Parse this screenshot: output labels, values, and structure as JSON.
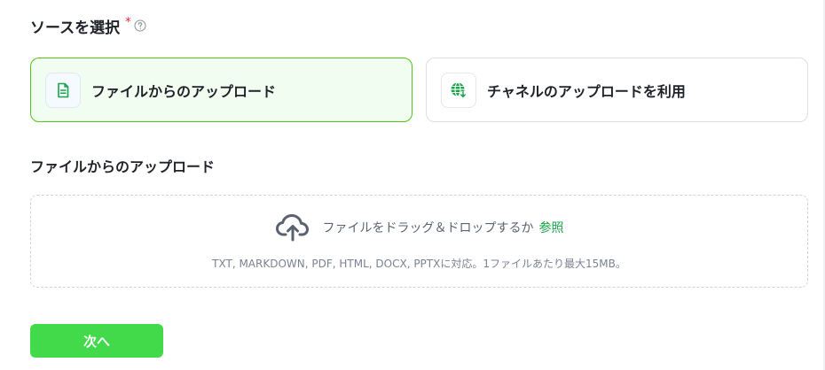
{
  "source_section": {
    "title": "ソースを選択",
    "required_mark": "*",
    "help_icon": "question-circle-icon"
  },
  "source_options": [
    {
      "label": "ファイルからのアップロード",
      "icon": "document-icon",
      "selected": true,
      "icon_color": "#1aa34a"
    },
    {
      "label": "チャネルのアップロードを利用",
      "icon": "globe-download-icon",
      "selected": false,
      "icon_color": "#1aa34a"
    }
  ],
  "upload_section": {
    "heading": "ファイルからのアップロード",
    "dropzone": {
      "icon": "cloud-upload-icon",
      "text": "ファイルをドラッグ＆ドロップするか",
      "browse_label": "参照",
      "hint": "TXT, MARKDOWN, PDF, HTML, DOCX, PPTXに対応。1ファイルあたり最大15MB。"
    }
  },
  "actions": {
    "next_label": "次へ"
  },
  "colors": {
    "accent": "#42d94b",
    "link": "#1aa34a",
    "selected_border": "#52c41a",
    "selected_bg": "#f1fdf1",
    "required": "#f5222d"
  }
}
